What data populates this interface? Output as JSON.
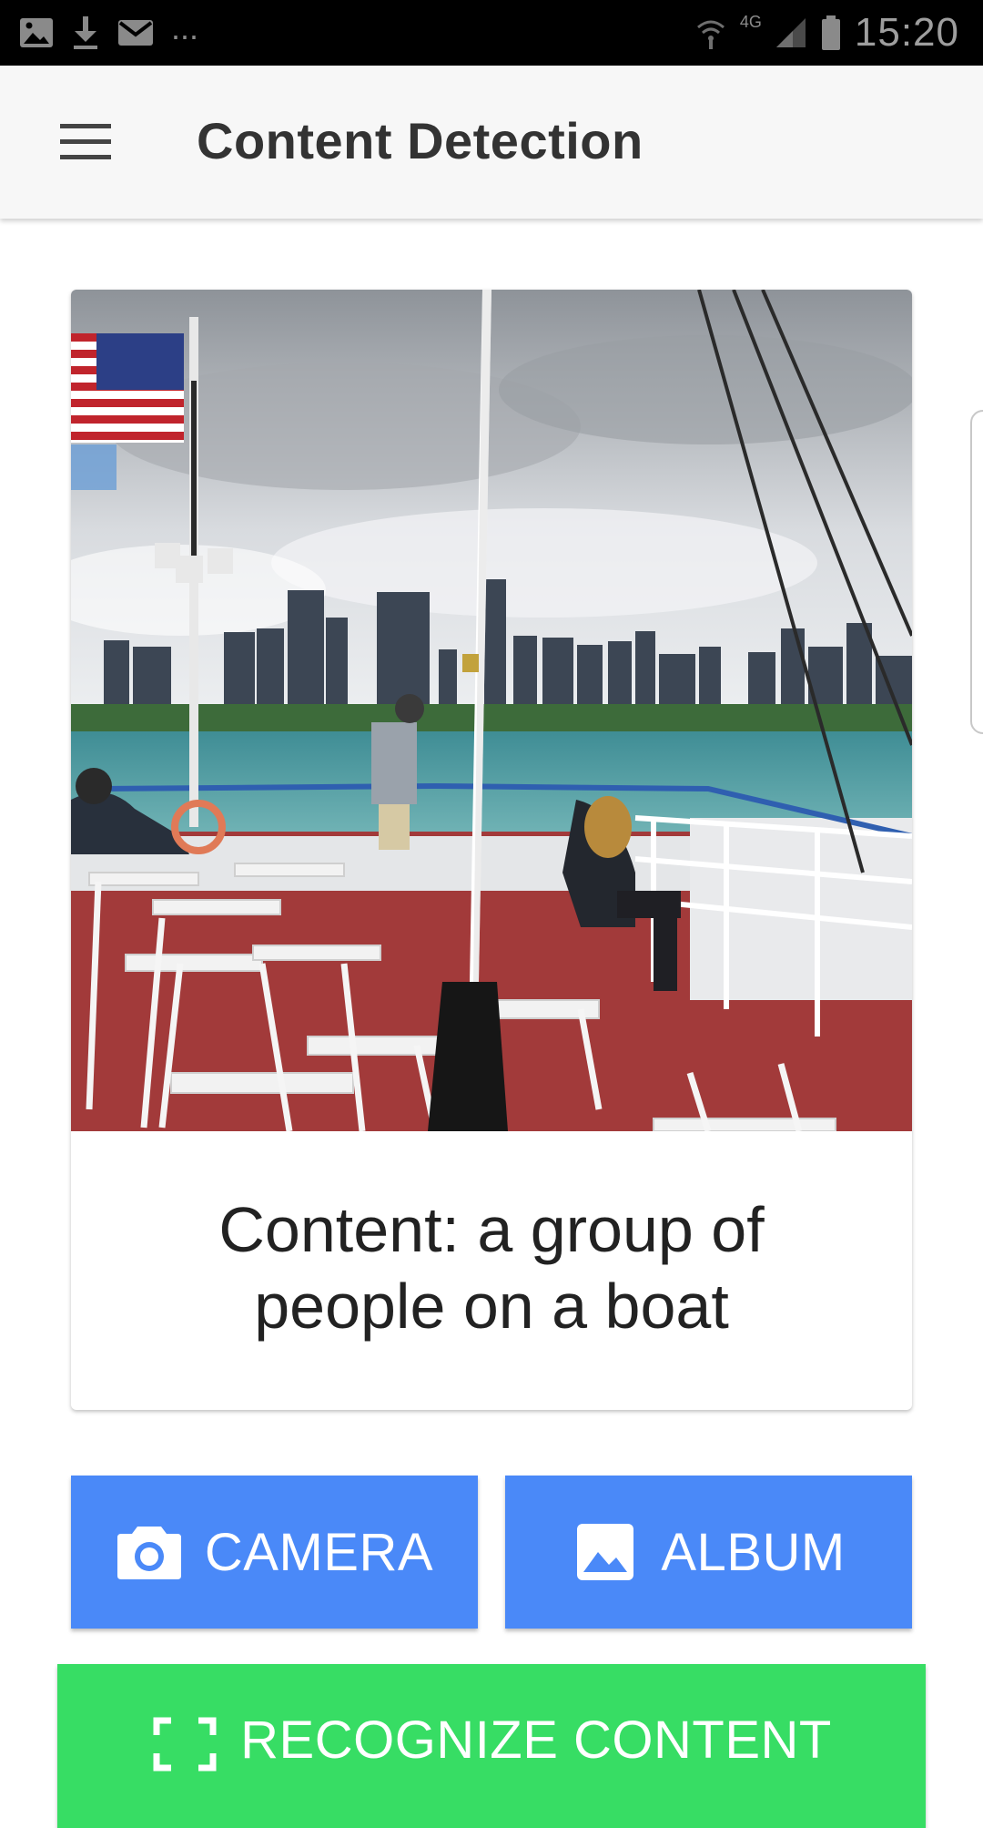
{
  "status_bar": {
    "time": "15:20",
    "overflow": "...",
    "network": "4G",
    "left_icons": [
      "image-notification-icon",
      "download-icon",
      "mail-icon"
    ],
    "right_icons": [
      "wifi-icon",
      "signal-icon",
      "battery-icon"
    ]
  },
  "app_bar": {
    "title": "Content Detection",
    "menu_icon": "hamburger-menu-icon"
  },
  "result": {
    "caption": "Content: a group of people on a boat"
  },
  "actions": {
    "camera_label": "CAMERA",
    "album_label": "ALBUM",
    "recognize_label": "RECOGNIZE CONTENT"
  },
  "colors": {
    "status_bar": "#000000",
    "app_bar": "#f7f7f7",
    "button_blue": "#4a89f8",
    "button_green": "#37dd64",
    "title_text": "#333333"
  }
}
